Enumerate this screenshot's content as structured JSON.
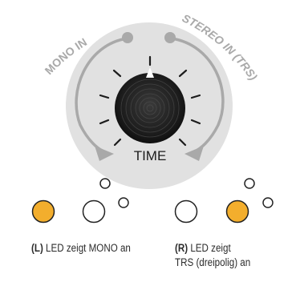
{
  "labels": {
    "mono_in": "MONO IN",
    "stereo_in": "STEREO IN (TRS)",
    "time": "TIME"
  },
  "captions": {
    "left_tag": "(L)",
    "left_text": " LED zeigt MONO an",
    "right_tag": "(R)",
    "right_text_1": " LED zeigt",
    "right_text_2": "TRS (dreipolig) an"
  },
  "leds": {
    "left_pair": {
      "mono_lit": true,
      "trs_lit": false
    },
    "right_pair": {
      "mono_lit": false,
      "trs_lit": true
    }
  },
  "colors": {
    "panel": "#e1e1e1",
    "arrow": "#a9a9a9",
    "led_on": "#f3ae2d",
    "led_outline": "#222222",
    "knob": "#1c1c1c",
    "text": "#2b2b2b"
  }
}
